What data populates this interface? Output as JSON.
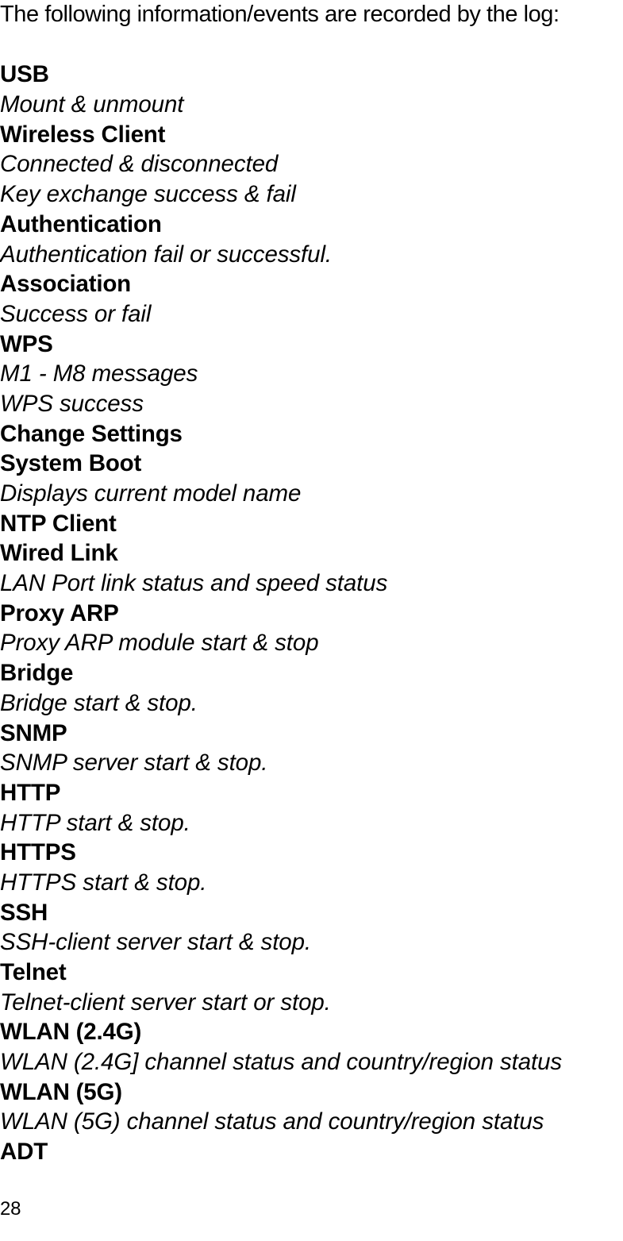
{
  "document": {
    "intro": "The following information/events are recorded by the log:",
    "page_number": "28",
    "text_color": "#000000",
    "background_color": "#ffffff"
  },
  "entries": [
    {
      "heading": "USB",
      "description": "Mount & unmount"
    },
    {
      "heading": "Wireless Client",
      "description": "Connected & disconnected"
    },
    {
      "heading": null,
      "description": "Key exchange success & fail"
    },
    {
      "heading": "Authentication",
      "description": "Authentication fail or successful."
    },
    {
      "heading": "Association",
      "description": "Success or fail"
    },
    {
      "heading": "WPS",
      "description": "M1 - M8 messages"
    },
    {
      "heading": null,
      "description": "WPS success"
    },
    {
      "heading": "Change Settings",
      "description": null
    },
    {
      "heading": "System Boot",
      "description": "Displays current model name"
    },
    {
      "heading": "NTP Client",
      "description": null
    },
    {
      "heading": "Wired Link",
      "description": "LAN Port link status and speed status"
    },
    {
      "heading": "Proxy ARP",
      "description": "Proxy ARP module start & stop"
    },
    {
      "heading": "Bridge",
      "description": "Bridge start & stop."
    },
    {
      "heading": "SNMP",
      "description": "SNMP server start & stop."
    },
    {
      "heading": "HTTP",
      "description": "HTTP start & stop."
    },
    {
      "heading": "HTTPS",
      "description": "HTTPS start & stop."
    },
    {
      "heading": "SSH",
      "description": "SSH-client server start & stop."
    },
    {
      "heading": "Telnet",
      "description": "Telnet-client server start or stop."
    },
    {
      "heading": "WLAN (2.4G)",
      "description": "WLAN (2.4G] channel status and country/region status"
    },
    {
      "heading": "WLAN (5G)",
      "description": "WLAN (5G) channel status and country/region status"
    },
    {
      "heading": "ADT",
      "description": null
    }
  ]
}
